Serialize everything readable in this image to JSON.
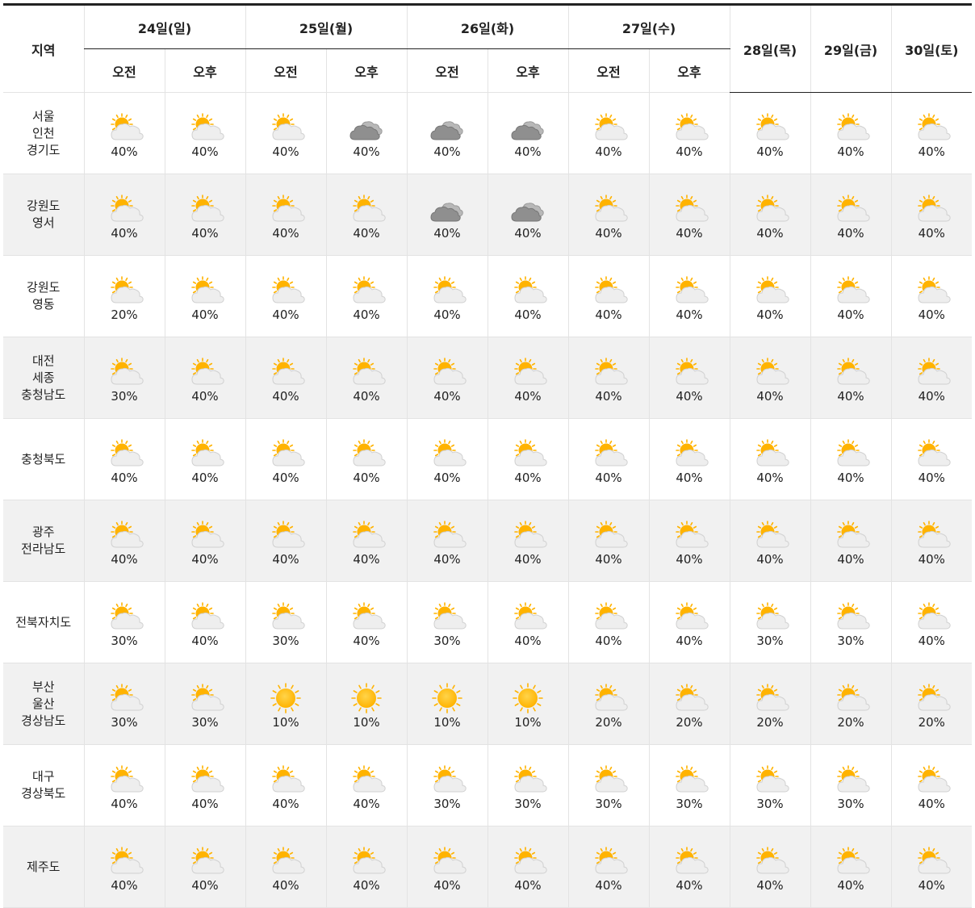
{
  "header": {
    "region_label": "지역",
    "days": [
      {
        "label": "24일(일)",
        "split": true
      },
      {
        "label": "25일(월)",
        "split": true
      },
      {
        "label": "26일(화)",
        "split": true
      },
      {
        "label": "27일(수)",
        "split": true
      },
      {
        "label": "28일(목)",
        "split": false
      },
      {
        "label": "29일(금)",
        "split": false
      },
      {
        "label": "30일(토)",
        "split": false
      }
    ],
    "am_label": "오전",
    "pm_label": "오후"
  },
  "icon_names": {
    "partly": "partly-cloudy-icon",
    "cloudy": "cloudy-icon",
    "sunny": "sunny-icon"
  },
  "colors": {
    "sun": "#ffb300",
    "cloud": "#eeeeee",
    "dark_cloud": "#8f8f8f",
    "stripe": "#f1f1f1"
  },
  "regions": [
    {
      "name": "서울\n인천\n경기도",
      "cells": [
        [
          "partly",
          "40%"
        ],
        [
          "partly",
          "40%"
        ],
        [
          "partly",
          "40%"
        ],
        [
          "cloudy",
          "40%"
        ],
        [
          "cloudy",
          "40%"
        ],
        [
          "cloudy",
          "40%"
        ],
        [
          "partly",
          "40%"
        ],
        [
          "partly",
          "40%"
        ],
        [
          "partly",
          "40%"
        ],
        [
          "partly",
          "40%"
        ],
        [
          "partly",
          "40%"
        ]
      ]
    },
    {
      "name": "강원도\n영서",
      "cells": [
        [
          "partly",
          "40%"
        ],
        [
          "partly",
          "40%"
        ],
        [
          "partly",
          "40%"
        ],
        [
          "partly",
          "40%"
        ],
        [
          "cloudy",
          "40%"
        ],
        [
          "cloudy",
          "40%"
        ],
        [
          "partly",
          "40%"
        ],
        [
          "partly",
          "40%"
        ],
        [
          "partly",
          "40%"
        ],
        [
          "partly",
          "40%"
        ],
        [
          "partly",
          "40%"
        ]
      ]
    },
    {
      "name": "강원도\n영동",
      "cells": [
        [
          "partly",
          "20%"
        ],
        [
          "partly",
          "40%"
        ],
        [
          "partly",
          "40%"
        ],
        [
          "partly",
          "40%"
        ],
        [
          "partly",
          "40%"
        ],
        [
          "partly",
          "40%"
        ],
        [
          "partly",
          "40%"
        ],
        [
          "partly",
          "40%"
        ],
        [
          "partly",
          "40%"
        ],
        [
          "partly",
          "40%"
        ],
        [
          "partly",
          "40%"
        ]
      ]
    },
    {
      "name": "대전\n세종\n충청남도",
      "cells": [
        [
          "partly",
          "30%"
        ],
        [
          "partly",
          "40%"
        ],
        [
          "partly",
          "40%"
        ],
        [
          "partly",
          "40%"
        ],
        [
          "partly",
          "40%"
        ],
        [
          "partly",
          "40%"
        ],
        [
          "partly",
          "40%"
        ],
        [
          "partly",
          "40%"
        ],
        [
          "partly",
          "40%"
        ],
        [
          "partly",
          "40%"
        ],
        [
          "partly",
          "40%"
        ]
      ]
    },
    {
      "name": "충청북도",
      "cells": [
        [
          "partly",
          "40%"
        ],
        [
          "partly",
          "40%"
        ],
        [
          "partly",
          "40%"
        ],
        [
          "partly",
          "40%"
        ],
        [
          "partly",
          "40%"
        ],
        [
          "partly",
          "40%"
        ],
        [
          "partly",
          "40%"
        ],
        [
          "partly",
          "40%"
        ],
        [
          "partly",
          "40%"
        ],
        [
          "partly",
          "40%"
        ],
        [
          "partly",
          "40%"
        ]
      ]
    },
    {
      "name": "광주\n전라남도",
      "cells": [
        [
          "partly",
          "40%"
        ],
        [
          "partly",
          "40%"
        ],
        [
          "partly",
          "40%"
        ],
        [
          "partly",
          "40%"
        ],
        [
          "partly",
          "40%"
        ],
        [
          "partly",
          "40%"
        ],
        [
          "partly",
          "40%"
        ],
        [
          "partly",
          "40%"
        ],
        [
          "partly",
          "40%"
        ],
        [
          "partly",
          "40%"
        ],
        [
          "partly",
          "40%"
        ]
      ]
    },
    {
      "name": "전북자치도",
      "cells": [
        [
          "partly",
          "30%"
        ],
        [
          "partly",
          "40%"
        ],
        [
          "partly",
          "30%"
        ],
        [
          "partly",
          "40%"
        ],
        [
          "partly",
          "30%"
        ],
        [
          "partly",
          "40%"
        ],
        [
          "partly",
          "40%"
        ],
        [
          "partly",
          "40%"
        ],
        [
          "partly",
          "30%"
        ],
        [
          "partly",
          "30%"
        ],
        [
          "partly",
          "40%"
        ]
      ]
    },
    {
      "name": "부산\n울산\n경상남도",
      "cells": [
        [
          "partly",
          "30%"
        ],
        [
          "partly",
          "30%"
        ],
        [
          "sunny",
          "10%"
        ],
        [
          "sunny",
          "10%"
        ],
        [
          "sunny",
          "10%"
        ],
        [
          "sunny",
          "10%"
        ],
        [
          "partly",
          "20%"
        ],
        [
          "partly",
          "20%"
        ],
        [
          "partly",
          "20%"
        ],
        [
          "partly",
          "20%"
        ],
        [
          "partly",
          "20%"
        ]
      ]
    },
    {
      "name": "대구\n경상북도",
      "cells": [
        [
          "partly",
          "40%"
        ],
        [
          "partly",
          "40%"
        ],
        [
          "partly",
          "40%"
        ],
        [
          "partly",
          "40%"
        ],
        [
          "partly",
          "30%"
        ],
        [
          "partly",
          "30%"
        ],
        [
          "partly",
          "30%"
        ],
        [
          "partly",
          "30%"
        ],
        [
          "partly",
          "30%"
        ],
        [
          "partly",
          "30%"
        ],
        [
          "partly",
          "40%"
        ]
      ]
    },
    {
      "name": "제주도",
      "cells": [
        [
          "partly",
          "40%"
        ],
        [
          "partly",
          "40%"
        ],
        [
          "partly",
          "40%"
        ],
        [
          "partly",
          "40%"
        ],
        [
          "partly",
          "40%"
        ],
        [
          "partly",
          "40%"
        ],
        [
          "partly",
          "40%"
        ],
        [
          "partly",
          "40%"
        ],
        [
          "partly",
          "40%"
        ],
        [
          "partly",
          "40%"
        ],
        [
          "partly",
          "40%"
        ]
      ]
    }
  ]
}
